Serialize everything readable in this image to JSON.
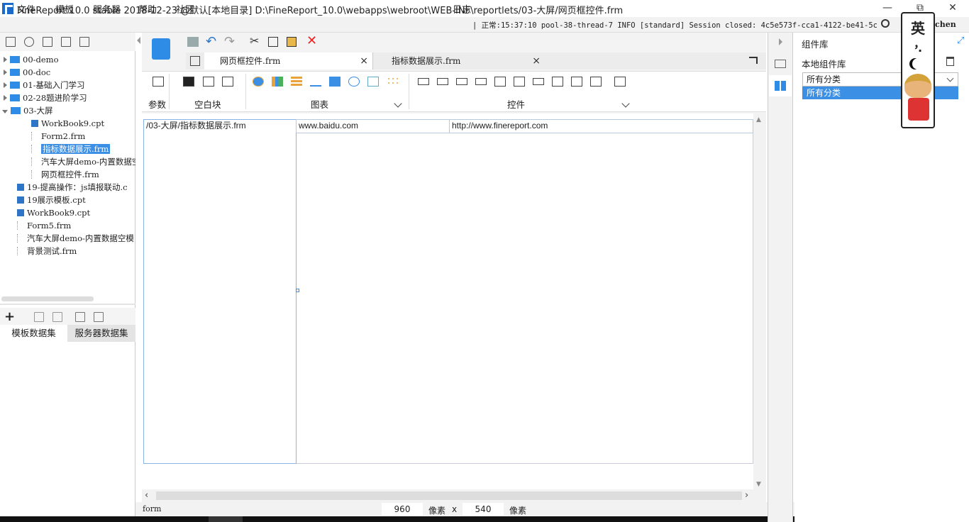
{
  "window": {
    "title": "FineReport 10.0 stable 2018-12-23 @默认[本地目录]    D:\\FineReport_10.0\\webapps\\webroot\\WEB-INF\\reportlets/03-大屏/网页框控件.frm",
    "min": "—",
    "max": "⧉",
    "close": "✕"
  },
  "menu": {
    "items": [
      "文件",
      "模板",
      "服务器",
      "帮助",
      "社区"
    ],
    "log_label": "日志",
    "log_text": "| 正常:15:37:10 pool-38-thread-7 INFO [standard] Session closed: 4c5e573f-cca1-4122-be41-5c5...",
    "user": "chen"
  },
  "tree": {
    "items": [
      {
        "label": "00-demo",
        "type": "folder",
        "depth": 0,
        "expanded": false
      },
      {
        "label": "00-doc",
        "type": "folder",
        "depth": 0,
        "expanded": false
      },
      {
        "label": "01-基础入门学习",
        "type": "folder",
        "depth": 0,
        "expanded": false
      },
      {
        "label": "02-28题进阶学习",
        "type": "folder",
        "depth": 0,
        "expanded": false
      },
      {
        "label": "03-大屏",
        "type": "folder",
        "depth": 0,
        "expanded": true
      },
      {
        "label": "WorkBook9.cpt",
        "type": "cpt",
        "depth": 1
      },
      {
        "label": "Form2.frm",
        "type": "file",
        "depth": 1
      },
      {
        "label": "指标数据展示.frm",
        "type": "file",
        "depth": 1,
        "selected": true
      },
      {
        "label": "汽车大屏demo-内置数据空",
        "type": "file",
        "depth": 1
      },
      {
        "label": "网页框控件.frm",
        "type": "file",
        "depth": 1
      },
      {
        "label": "19-提高操作：js填报联动.c",
        "type": "cpt",
        "depth": 0
      },
      {
        "label": "19展示模板.cpt",
        "type": "cpt",
        "depth": 0
      },
      {
        "label": "WorkBook9.cpt",
        "type": "cpt",
        "depth": 0
      },
      {
        "label": "Form5.frm",
        "type": "file",
        "depth": 0
      },
      {
        "label": "汽车大屏demo-内置数据空模",
        "type": "file",
        "depth": 0
      },
      {
        "label": "背景测试.frm",
        "type": "file",
        "depth": 0
      }
    ]
  },
  "dataset_tabs": [
    "模板数据集",
    "服务器数据集"
  ],
  "tabs": [
    {
      "label": "网页框控件.frm",
      "close": "×"
    },
    {
      "label": "指标数据展示.frm",
      "close": "×"
    }
  ],
  "widget_groups": {
    "param": "参数",
    "blank": "空白块",
    "chart": "图表",
    "control": "控件"
  },
  "canvas": {
    "cells": [
      "/03-大屏/指标数据展示.frm",
      "www.baidu.com",
      "http://www.finereport.com"
    ]
  },
  "status": {
    "mode": "form",
    "width": "960",
    "unit1": "像素",
    "x": "x",
    "height": "540",
    "unit2": "像素"
  },
  "right": {
    "title": "组件库",
    "local": "本地组件库",
    "dropdown_value": "所有分类",
    "dropdown_option": "所有分类"
  },
  "sticker": {
    "char1": "英",
    "char2": "，",
    "char3": "·"
  },
  "colors": {
    "accent": "#3b8fe4",
    "folder": "#2e8be6"
  }
}
